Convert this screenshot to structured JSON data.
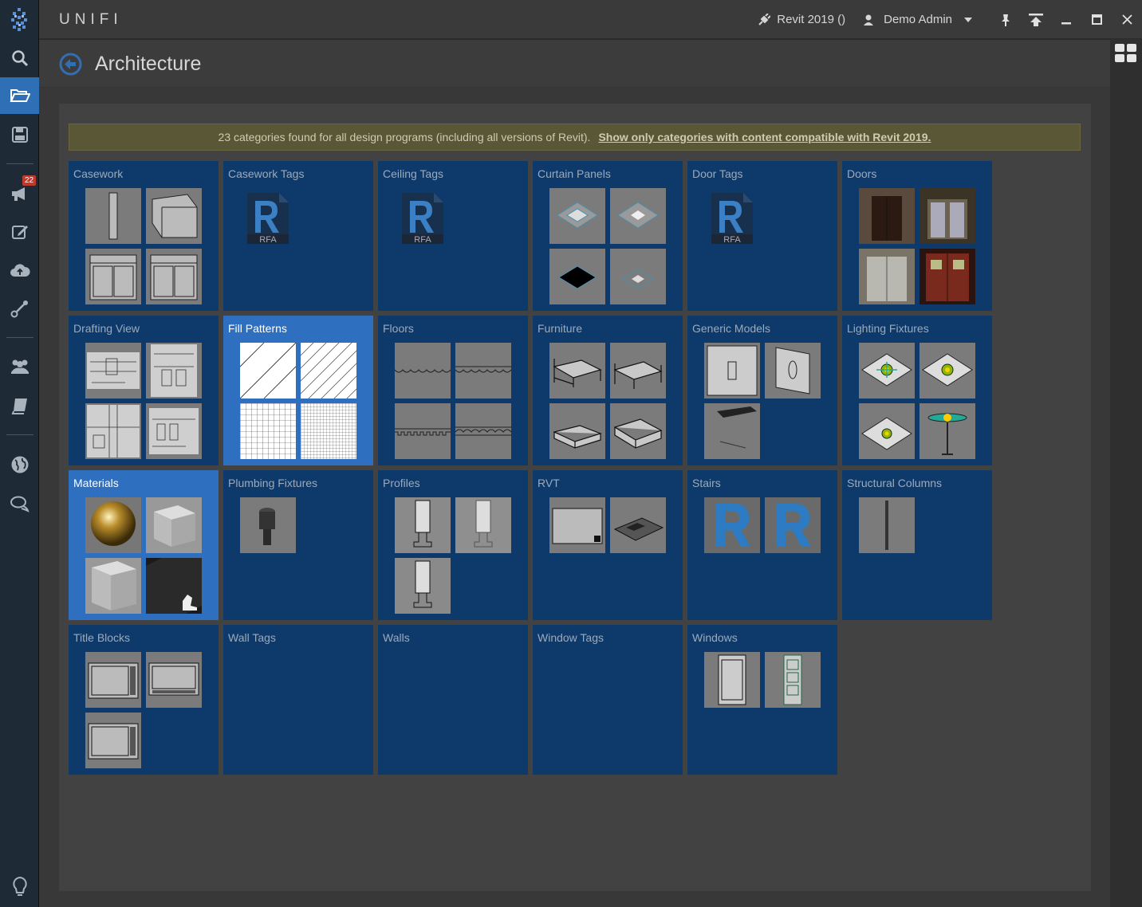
{
  "app": {
    "brand": "UNIFI"
  },
  "topbar": {
    "revit_label": "Revit 2019 ()",
    "user_label": "Demo Admin"
  },
  "nav": {
    "badge_count": "22"
  },
  "page": {
    "title": "Architecture"
  },
  "notice": {
    "text": "23 categories found for all design programs (including all versions of Revit).",
    "link": "Show only categories with content compatible with Revit 2019."
  },
  "tiles": [
    {
      "label": "Casework"
    },
    {
      "label": "Casework Tags"
    },
    {
      "label": "Ceiling Tags"
    },
    {
      "label": "Curtain Panels"
    },
    {
      "label": "Door Tags"
    },
    {
      "label": "Doors"
    },
    {
      "label": "Drafting View"
    },
    {
      "label": "Fill Patterns"
    },
    {
      "label": "Floors"
    },
    {
      "label": "Furniture"
    },
    {
      "label": "Generic Models"
    },
    {
      "label": "Lighting Fixtures"
    },
    {
      "label": "Materials"
    },
    {
      "label": "Plumbing Fixtures"
    },
    {
      "label": "Profiles"
    },
    {
      "label": "RVT"
    },
    {
      "label": "Stairs"
    },
    {
      "label": "Structural Columns"
    },
    {
      "label": "Title Blocks"
    },
    {
      "label": "Wall Tags"
    },
    {
      "label": "Walls"
    },
    {
      "label": "Window Tags"
    },
    {
      "label": "Windows"
    }
  ],
  "rfa_label": "RFA",
  "colors": {
    "tile": "#0d3a6b",
    "tile_selected": "#2e6fc0",
    "accent": "#2f6fb5"
  }
}
